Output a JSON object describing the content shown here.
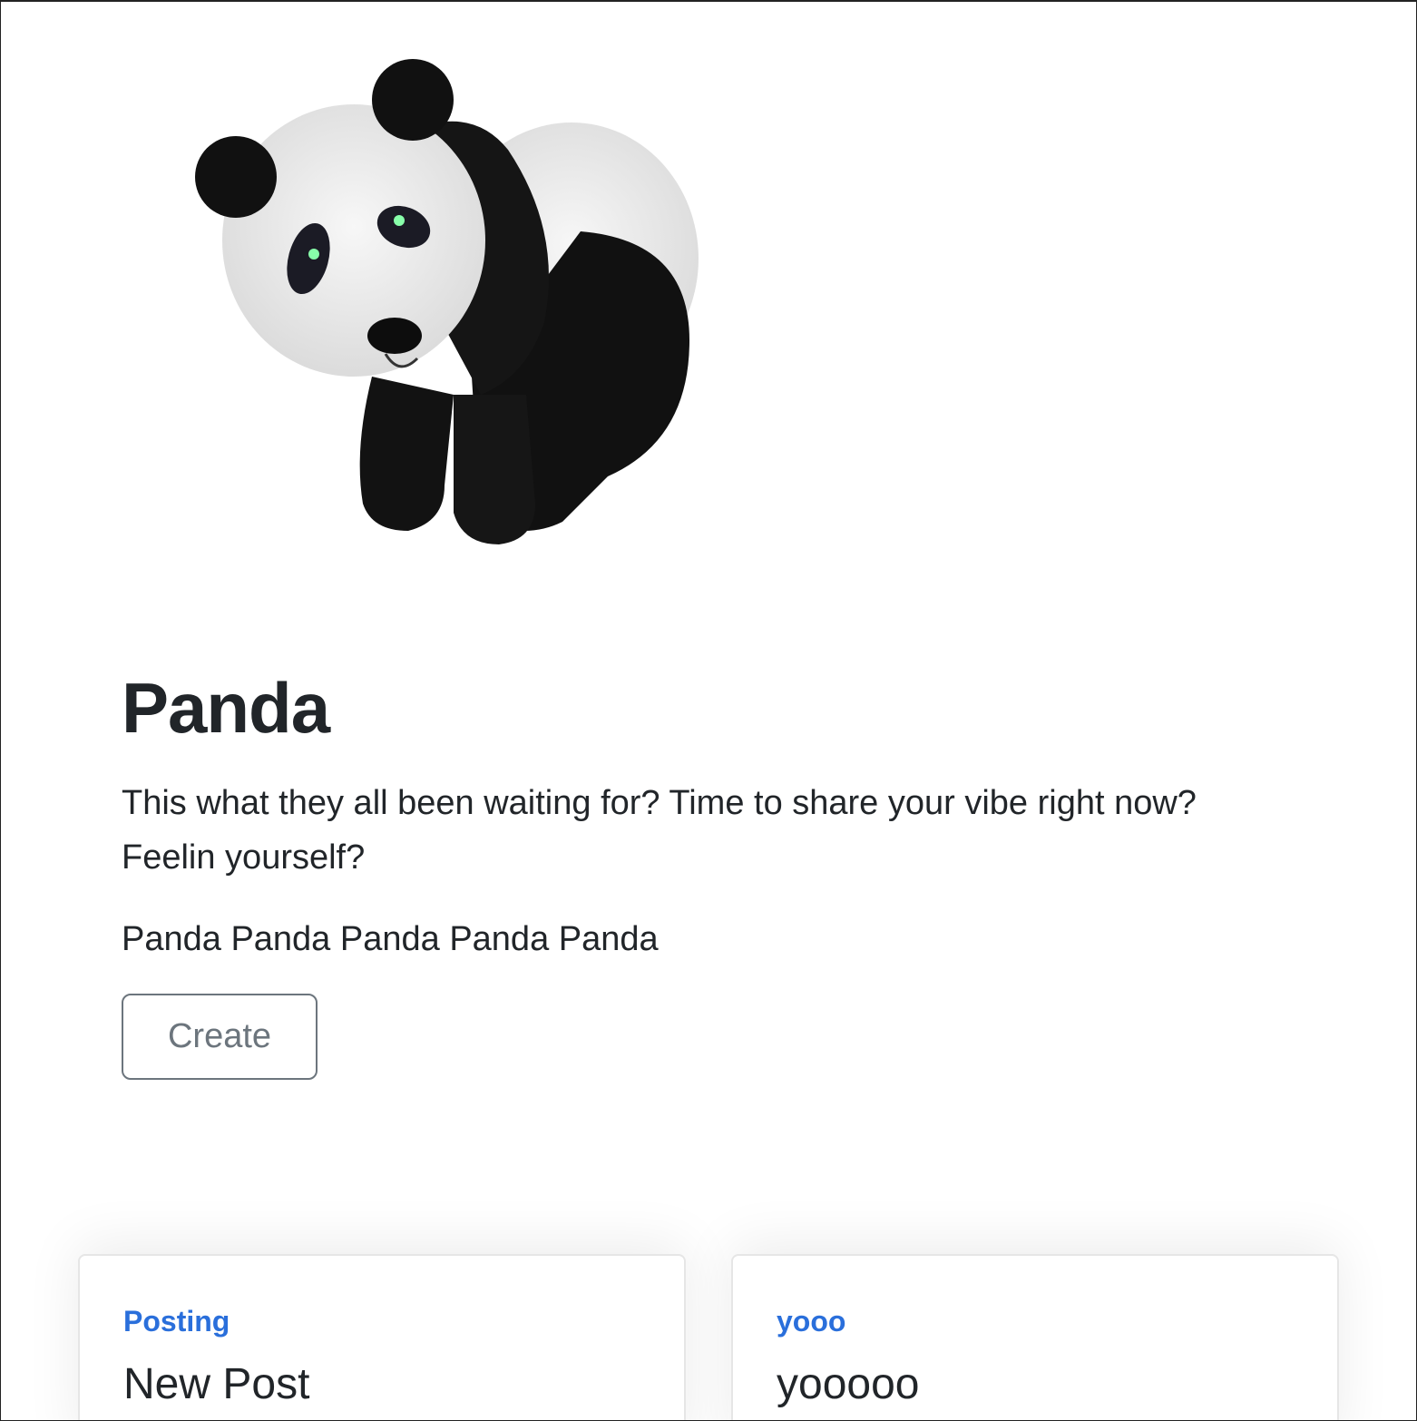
{
  "hero": {
    "image_alt": "panda",
    "title": "Panda",
    "lead": "This what they all been waiting for? Time to share your vibe right now? Feelin yourself?",
    "sub": "Panda Panda Panda Panda Panda",
    "create_label": "Create"
  },
  "posts": [
    {
      "category": "Posting",
      "title": "New Post"
    },
    {
      "category": "yooo",
      "title": "yooooo"
    }
  ],
  "colors": {
    "accent": "#2a6fdb",
    "text": "#212529",
    "button_border": "#6c757d"
  }
}
